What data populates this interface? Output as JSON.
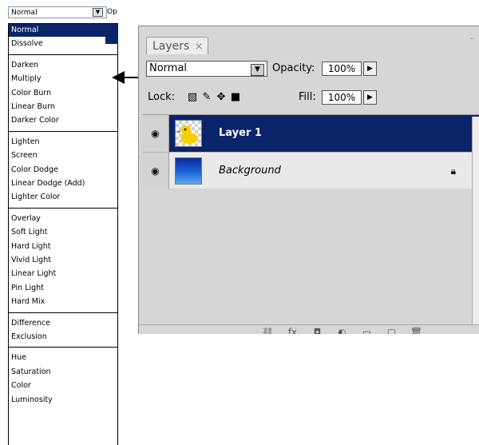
{
  "mini_dropdown": {
    "value": "Normal",
    "opacity_label_fragment": "Op"
  },
  "blend_menu": {
    "groups": [
      [
        "Normal",
        "Dissolve"
      ],
      [
        "Darken",
        "Multiply",
        "Color Burn",
        "Linear Burn",
        "Darker Color"
      ],
      [
        "Lighten",
        "Screen",
        "Color Dodge",
        "Linear Dodge (Add)",
        "Lighter Color"
      ],
      [
        "Overlay",
        "Soft Light",
        "Hard Light",
        "Vivid Light",
        "Linear Light",
        "Pin Light",
        "Hard Mix"
      ],
      [
        "Difference",
        "Exclusion"
      ],
      [
        "Hue",
        "Saturation",
        "Color",
        "Luminosity"
      ]
    ],
    "selected": "Normal"
  },
  "panel": {
    "tab_label": "Layers",
    "tab_close": "×",
    "blend_mode": "Normal",
    "opacity_label": "Opacity:",
    "opacity_value": "100%",
    "lock_label": "Lock:",
    "fill_label": "Fill:",
    "fill_value": "100%",
    "layers": [
      {
        "name": "Layer 1",
        "active": true
      },
      {
        "name": "Background",
        "active": false,
        "locked": true
      }
    ]
  },
  "colors": {
    "selection": "#0a246a",
    "panel_bg": "#d6d6d6"
  },
  "icons": {
    "eye": "eye-icon",
    "lock": "lock-icon",
    "lock_transparency": "lock-transparent-pixels-icon",
    "lock_image": "brush-icon",
    "lock_position": "move-icon",
    "lock_all": "lock-all-icon"
  }
}
